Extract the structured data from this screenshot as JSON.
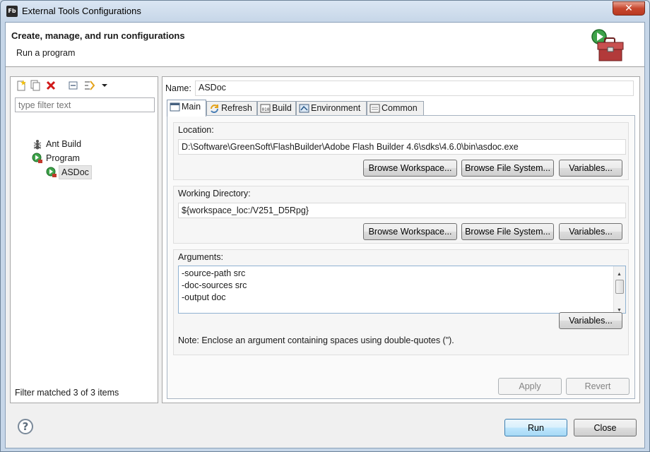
{
  "window": {
    "title": "External Tools Configurations",
    "app_icon_text": "Fb",
    "close_glyph": "✕"
  },
  "header": {
    "title": "Create, manage, and run configurations",
    "subtitle": "Run a program"
  },
  "left_pane": {
    "toolbar_icons": [
      "new-configuration-icon",
      "duplicate-icon",
      "delete-icon",
      "collapse-all-icon",
      "filter-icon",
      "dropdown-arrow-icon"
    ],
    "filter_placeholder": "type filter text",
    "tree": [
      {
        "label": "Ant Build",
        "icon": "ant-icon",
        "level": 0
      },
      {
        "label": "Program",
        "icon": "program-icon",
        "level": 0
      },
      {
        "label": "ASDoc",
        "icon": "program-config-icon",
        "level": 1,
        "selected": true
      }
    ],
    "status": "Filter matched 3 of 3 items"
  },
  "right_pane": {
    "name_label": "Name:",
    "name_value": "ASDoc",
    "tabs": [
      {
        "label": "Main",
        "icon": "main-tab-icon",
        "active": true
      },
      {
        "label": "Refresh",
        "icon": "refresh-tab-icon"
      },
      {
        "label": "Build",
        "icon": "build-tab-icon"
      },
      {
        "label": "Environment",
        "icon": "environment-tab-icon"
      },
      {
        "label": "Common",
        "icon": "common-tab-icon"
      }
    ],
    "location": {
      "label": "Location:",
      "value": "D:\\Software\\GreenSoft\\FlashBuilder\\Adobe Flash Builder 4.6\\sdks\\4.6.0\\bin\\asdoc.exe",
      "browse_workspace": "Browse Workspace...",
      "browse_file_system": "Browse File System...",
      "variables": "Variables..."
    },
    "working_directory": {
      "label": "Working Directory:",
      "value": "${workspace_loc:/V251_D5Rpg}",
      "browse_workspace": "Browse Workspace...",
      "browse_file_system": "Browse File System...",
      "variables": "Variables..."
    },
    "arguments": {
      "label": "Arguments:",
      "lines": [
        "-source-path src",
        "-doc-sources src",
        "-output doc"
      ],
      "variables": "Variables...",
      "note": "Note: Enclose an argument containing spaces using double-quotes (\")."
    },
    "apply": "Apply",
    "revert": "Revert"
  },
  "footer": {
    "help_glyph": "?",
    "run": "Run",
    "close": "Close"
  }
}
